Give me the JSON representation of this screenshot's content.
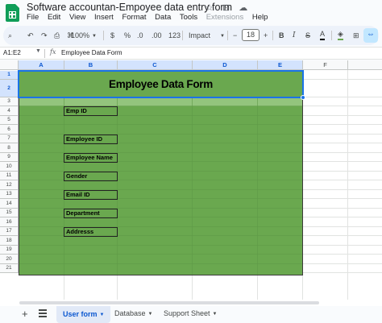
{
  "app": {
    "title": "Software accountan-Empoyee data entry form",
    "title_icons": [
      "star-icon",
      "move-to-folder-icon",
      "cloud-status-icon"
    ],
    "menu": [
      "File",
      "Edit",
      "View",
      "Insert",
      "Format",
      "Data",
      "Tools",
      "Extensions",
      "Help"
    ]
  },
  "toolbar": {
    "zoom": "100%",
    "currency": "$",
    "percent": "%",
    "decrease_decimal": ".0",
    "increase_decimal": ".00",
    "number_format": "123",
    "font": "Impact",
    "font_size": "18",
    "bold": "B"
  },
  "formula_bar": {
    "name_box": "A1:E2",
    "fx": "fx",
    "content": "Employee Data Form"
  },
  "grid": {
    "columns": [
      "A",
      "B",
      "C",
      "D",
      "E",
      "F"
    ],
    "rows": [
      "1",
      "2",
      "3",
      "4",
      "5",
      "6",
      "7",
      "8",
      "9",
      "10",
      "11",
      "12",
      "13",
      "14",
      "15",
      "16",
      "17",
      "18",
      "19",
      "20",
      "21"
    ],
    "selected_range": "A1:E2"
  },
  "form": {
    "title": "Employee Data Form",
    "fields": [
      {
        "label": "Emp ID",
        "row": "4"
      },
      {
        "label": "Employee ID",
        "row": "7"
      },
      {
        "label": "Employee Name",
        "row": "9"
      },
      {
        "label": "Gender",
        "row": "11"
      },
      {
        "label": "Email ID",
        "row": "13"
      },
      {
        "label": "Department",
        "row": "15"
      },
      {
        "label": "Addresss",
        "row": "17"
      }
    ],
    "fill_color": "#6aa84f",
    "band_color": "#93c47d"
  },
  "sheets": {
    "tabs": [
      {
        "label": "User form",
        "active": true
      },
      {
        "label": "Database",
        "active": false
      },
      {
        "label": "Support Sheet",
        "active": false
      }
    ]
  }
}
